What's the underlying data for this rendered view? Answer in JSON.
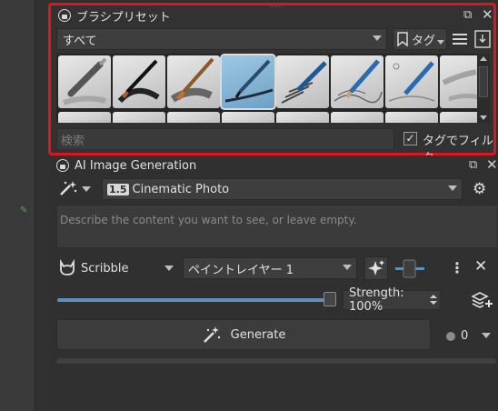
{
  "brush_panel": {
    "title": "ブラシプリセット",
    "filter_combo": "すべて",
    "tag_button": "タグ",
    "search_placeholder": "検索",
    "tag_filter_label": "タグでフィルタ",
    "tag_filter_checked": true
  },
  "ai_panel": {
    "title": "AI Image Generation",
    "model_version_badge": "1.5",
    "style_combo": "Cinematic Photo",
    "prompt_placeholder": "Describe the content you want to see, or leave empty.",
    "control_mode": "Scribble",
    "layer_combo": "ペイントレイヤー 1",
    "strength_label": "Strength: 100%",
    "strength_value": 1.0,
    "generate_label": "Generate",
    "queue_count": "0"
  },
  "colors": {
    "highlight_border": "#e0141e",
    "slider_fill": "#5e90b8"
  }
}
